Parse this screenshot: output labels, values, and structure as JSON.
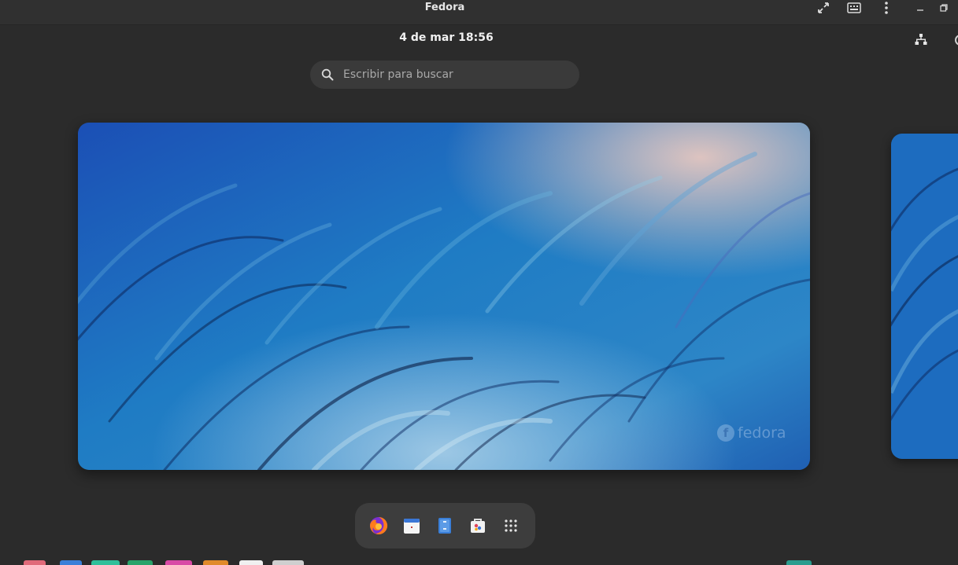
{
  "window": {
    "title": "Fedora",
    "controls": [
      "fullscreen-icon",
      "keyboard-icon",
      "more-vert-icon",
      "minimize-icon",
      "restore-icon"
    ]
  },
  "topbar": {
    "clock": "4 de mar  18:56",
    "status_icons": [
      "network-wired-icon"
    ]
  },
  "search": {
    "placeholder": "Escribir para buscar",
    "value": ""
  },
  "workspace": {
    "watermark": "fedora"
  },
  "dash": {
    "apps": [
      {
        "name": "Firefox",
        "icon": "firefox-icon"
      },
      {
        "name": "Calendar",
        "icon": "calendar-icon"
      },
      {
        "name": "Files",
        "icon": "files-icon"
      },
      {
        "name": "Software",
        "icon": "software-icon"
      },
      {
        "name": "Show Applications",
        "icon": "app-grid-icon"
      }
    ]
  },
  "colors": {
    "background": "#2b2b2b",
    "panel": "#3a3a3a",
    "accent": "#1f6fc0"
  }
}
